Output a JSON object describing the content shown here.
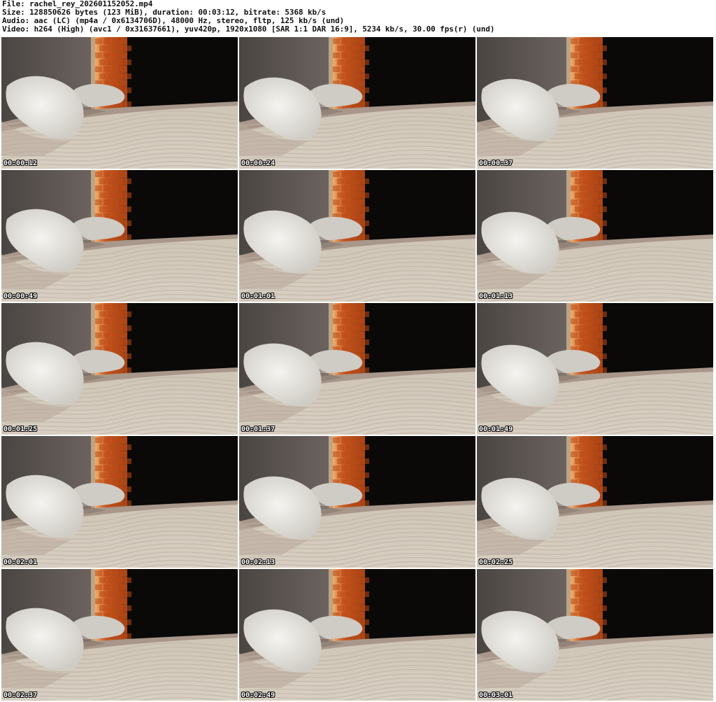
{
  "header": {
    "file_line": "File: rachel_rey_202601152052.mp4",
    "size_line": "Size: 128850626 bytes (123 MiB), duration: 00:03:12, bitrate: 5368 kb/s",
    "audio_line": "Audio: aac (LC) (mp4a / 0x6134706D), 48000 Hz, stereo, fltp, 125 kb/s (und)",
    "video_line": "Video: h264 (High) (avc1 / 0x31637661), yuv420p, 1920x1080 [SAR 1:1 DAR 16:9], 5234 kb/s, 30.00 fps(r) (und)"
  },
  "thumbnails": [
    {
      "timestamp": "00:00:12"
    },
    {
      "timestamp": "00:00:24"
    },
    {
      "timestamp": "00:00:37"
    },
    {
      "timestamp": "00:00:49"
    },
    {
      "timestamp": "00:01:01"
    },
    {
      "timestamp": "00:01:13"
    },
    {
      "timestamp": "00:01:25"
    },
    {
      "timestamp": "00:01:37"
    },
    {
      "timestamp": "00:01:49"
    },
    {
      "timestamp": "00:02:01"
    },
    {
      "timestamp": "00:02:13"
    },
    {
      "timestamp": "00:02:25"
    },
    {
      "timestamp": "00:02:37"
    },
    {
      "timestamp": "00:02:49"
    },
    {
      "timestamp": "00:03:01"
    }
  ],
  "colors": {
    "background": "#ffffff",
    "header_text": "#111111",
    "wall_gray": "#5a5552",
    "brick_orange": "#c8561e",
    "dark_area": "#0a0908",
    "bedsheet": "#d8cfc2",
    "pillow": "#e9e7e2"
  }
}
